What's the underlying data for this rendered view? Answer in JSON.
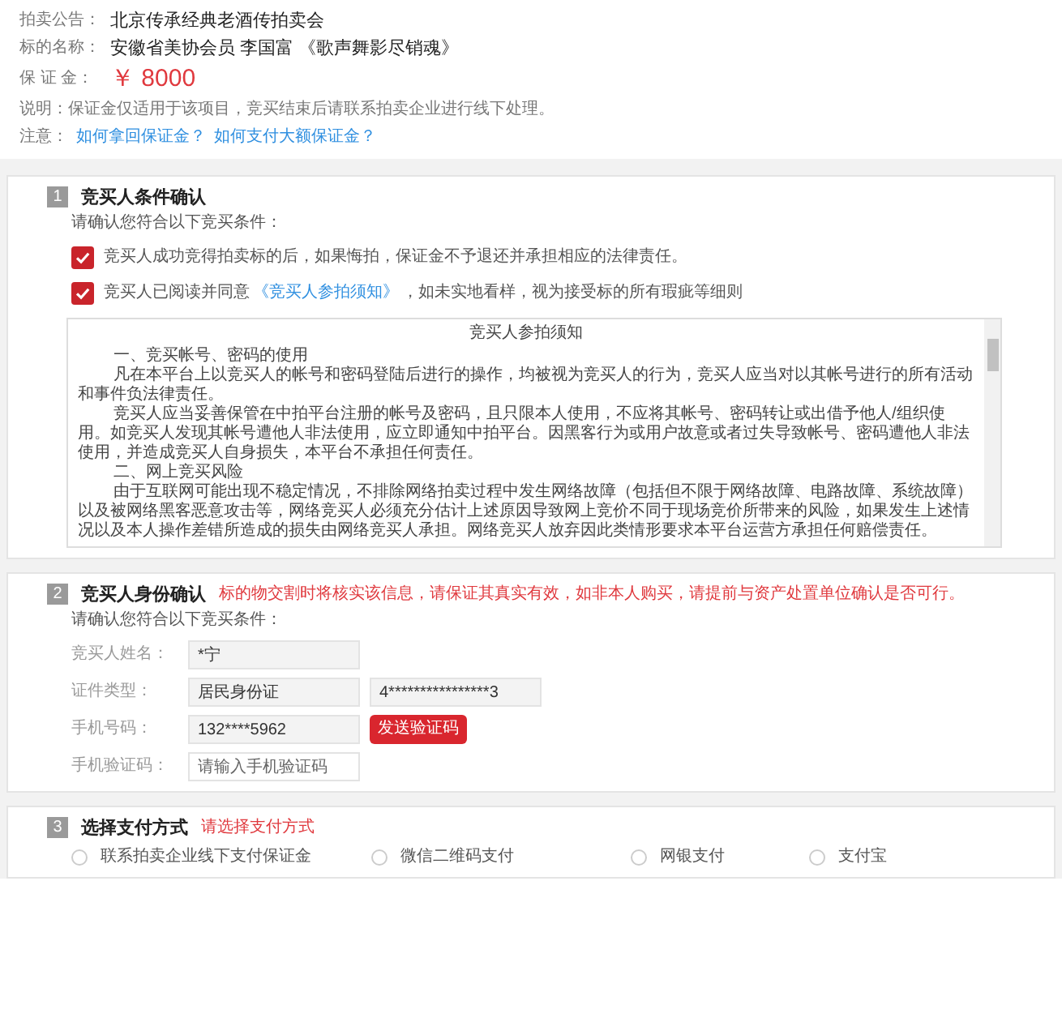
{
  "summary": {
    "rows": [
      {
        "label": "拍卖公告：",
        "value": "北京传承经典老酒传拍卖会",
        "kind": "text"
      },
      {
        "label": "标的名称：",
        "value": "安徽省美协会员 李国富 《歌声舞影尽销魂》",
        "kind": "text"
      },
      {
        "label": "保 证 金：",
        "value": "￥ 8000",
        "kind": "price"
      }
    ],
    "note": {
      "label": "说明：",
      "text": "保证金仅适用于该项目，竞买结束后请联系拍卖企业进行线下处理。"
    },
    "links": {
      "label": "注意：",
      "items": [
        "如何拿回保证金？",
        "如何支付大额保证金？"
      ]
    }
  },
  "section1": {
    "number": "1",
    "title": "竞买人条件确认",
    "subtitle": "请确认您符合以下竞买条件：",
    "conditions": [
      {
        "checked": true,
        "before": "竞买人成功竞得拍卖标的后，如果悔拍，保证金不予退还并承担相应的法律责任。"
      },
      {
        "checked": true,
        "before": "竞买人已阅读并同意",
        "link": "《竞买人参拍须知》",
        "after": "，如未实地看样，视为接受标的所有瑕疵等细则"
      }
    ],
    "notice": {
      "title": "竞买人参拍须知",
      "paragraphs": [
        {
          "kind": "heading",
          "text": "一、竞买帐号、密码的使用"
        },
        {
          "kind": "body",
          "text": "凡在本平台上以竞买人的帐号和密码登陆后进行的操作，均被视为竞买人的行为，竞买人应当对以其帐号进行的所有活动和事件负法律责任。"
        },
        {
          "kind": "body",
          "text": "竞买人应当妥善保管在中拍平台注册的帐号及密码，且只限本人使用，不应将其帐号、密码转让或出借予他人/组织使用。如竞买人发现其帐号遭他人非法使用，应立即通知中拍平台。因黑客行为或用户故意或者过失导致帐号、密码遭他人非法使用，并造成竞买人自身损失，本平台不承担任何责任。"
        },
        {
          "kind": "heading",
          "text": "二、网上竞买风险"
        },
        {
          "kind": "body",
          "text": "由于互联网可能出现不稳定情况，不排除网络拍卖过程中发生网络故障（包括但不限于网络故障、电路故障、系统故障）以及被网络黑客恶意攻击等，网络竞买人必须充分估计上述原因导致网上竞价不同于现场竞价所带来的风险，如果发生上述情况以及本人操作差错所造成的损失由网络竞买人承担。网络竞买人放弃因此类情形要求本平台运营方承担任何赔偿责任。"
        }
      ]
    }
  },
  "section2": {
    "number": "2",
    "title": "竞买人身份确认",
    "warning": "标的物交割时将核实该信息，请保证其真实有效，如非本人购买，请提前与资产处置单位确认是否可行。",
    "subtitle": "请确认您符合以下竞买条件：",
    "fields": [
      {
        "label": "竞买人姓名：",
        "inputs": [
          {
            "value": "*宁",
            "readonly": true
          }
        ]
      },
      {
        "label": "证件类型：",
        "inputs": [
          {
            "value": "居民身份证",
            "readonly": true
          },
          {
            "value": "4****************3",
            "readonly": true
          }
        ]
      },
      {
        "label": "手机号码：",
        "inputs": [
          {
            "value": "132****5962",
            "readonly": true
          }
        ],
        "button": "发送验证码"
      },
      {
        "label": "手机验证码：",
        "inputs": [
          {
            "placeholder": "请输入手机验证码",
            "readonly": false
          }
        ]
      }
    ]
  },
  "section3": {
    "number": "3",
    "title": "选择支付方式",
    "warning": "请选择支付方式",
    "options": [
      {
        "label": "联系拍卖企业线下支付保证金",
        "selected": false
      },
      {
        "label": "微信二维码支付",
        "selected": false
      },
      {
        "label": "网银支付",
        "selected": false
      },
      {
        "label": "支付宝",
        "selected": false
      }
    ]
  }
}
